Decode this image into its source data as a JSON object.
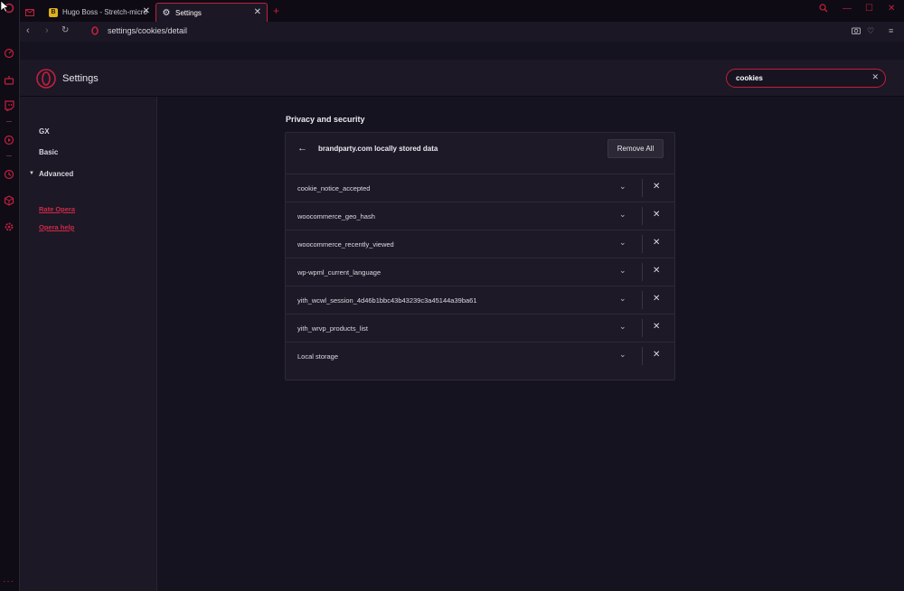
{
  "tabs": [
    {
      "label": "",
      "icon": "mail-icon"
    },
    {
      "label": "Hugo Boss - Stretch-micro",
      "icon": "hugo-favicon"
    },
    {
      "label": "Settings",
      "icon": "gear-icon",
      "active": true
    }
  ],
  "address": {
    "url": "settings/cookies/detail"
  },
  "header": {
    "title": "Settings"
  },
  "search": {
    "value": "cookies",
    "clear_label": "✕"
  },
  "nav": {
    "items": [
      "GX",
      "Basic",
      "Advanced"
    ],
    "links": [
      "Rate Opera",
      "Opera help"
    ]
  },
  "content": {
    "section_title": "Privacy and security",
    "card_title": "brandparty.com locally stored data",
    "remove_all_label": "Remove All",
    "rows": [
      "cookie_notice_accepted",
      "woocommerce_geo_hash",
      "woocommerce_recently_viewed",
      "wp-wpml_current_language",
      "yith_wcwl_session_4d46b1bbc43b43239c3a45144a39ba61",
      "yith_wrvp_products_list",
      "Local storage"
    ]
  },
  "colors": {
    "accent": "#c2203e",
    "background": "#161320",
    "panel": "#1c1826"
  }
}
